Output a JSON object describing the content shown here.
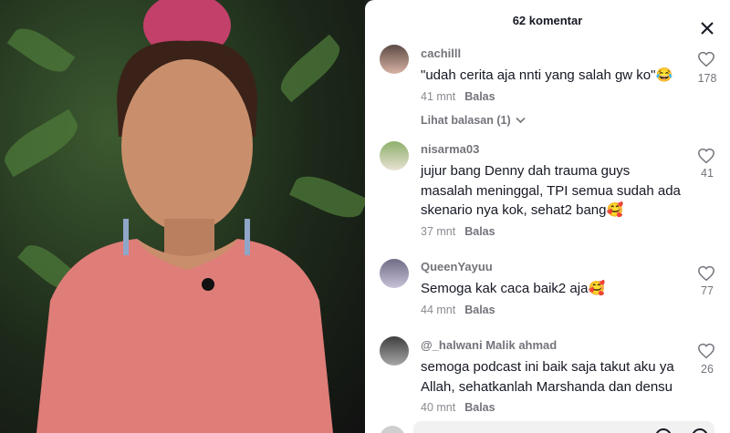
{
  "header": {
    "title": "62 komentar"
  },
  "comments": [
    {
      "username": "cachilll",
      "text": "\"udah cerita aja nnti yang salah gw ko\"😂",
      "time": "41 mnt",
      "reply": "Balas",
      "likes": "178",
      "view_replies": "Lihat balasan (1)"
    },
    {
      "username": "nisarma03",
      "text": "jujur bang Denny dah trauma guys masalah meninggal, TPI semua sudah ada skenario nya kok, sehat2 bang🥰",
      "time": "37 mnt",
      "reply": "Balas",
      "likes": "41"
    },
    {
      "username": "QueenYayuu",
      "text": "Semoga kak caca baik2 aja🥰",
      "time": "44 mnt",
      "reply": "Balas",
      "likes": "77"
    },
    {
      "username": "@_halwani Malik ahmad",
      "text": "semoga podcast ini baik saja takut aku ya Allah, sehatkanlah Marshanda dan densu",
      "time": "40 mnt",
      "reply": "Balas",
      "likes": "26"
    }
  ],
  "colors": {
    "panel_bg": "#ffffff",
    "text": "#161823",
    "muted": "#73747b"
  },
  "icons": {
    "close": "close-icon",
    "like": "heart-outline-icon",
    "expand": "chevron-down-icon"
  }
}
